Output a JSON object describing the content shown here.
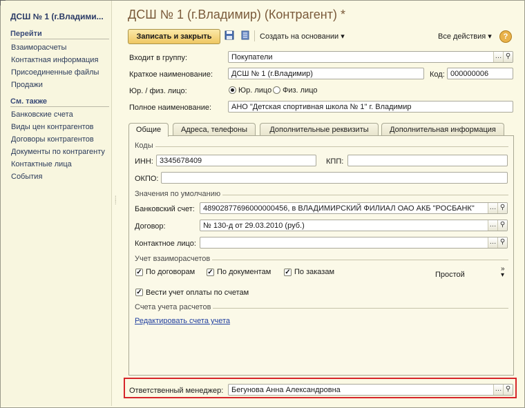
{
  "left": {
    "title": "ДСШ № 1 (г.Владими...",
    "section_go": "Перейти",
    "go_items": [
      "Взаиморасчеты",
      "Контактная информация",
      "Присоединенные файлы",
      "Продажи"
    ],
    "section_see": "См. также",
    "see_items": [
      "Банковские счета",
      "Виды цен контрагентов",
      "Договоры контрагентов",
      "Документы по контрагенту",
      "Контактные лица",
      "События"
    ]
  },
  "header": {
    "title": "ДСШ № 1 (г.Владимир) (Контрагент) *"
  },
  "toolbar": {
    "save_close": "Записать и закрыть",
    "create_based": "Создать на основании",
    "all_actions": "Все действия",
    "help": "?"
  },
  "form": {
    "group_label": "Входит в группу:",
    "group_value": "Покупатели",
    "short_name_label": "Краткое наименование:",
    "short_name_value": "ДСШ № 1 (г.Владимир)",
    "code_label": "Код:",
    "code_value": "000000006",
    "entity_label": "Юр. / физ. лицо:",
    "entity_options": [
      "Юр. лицо",
      "Физ. лицо"
    ],
    "full_name_label": "Полное наименование:",
    "full_name_value": "АНО \"Детская спортивная школа  № 1\" г. Владимир"
  },
  "tabs": [
    "Общие",
    "Адреса, телефоны",
    "Дополнительные реквизиты",
    "Дополнительная информация"
  ],
  "general": {
    "codes_group": "Коды",
    "inn_label": "ИНН:",
    "inn_value": "3345678409",
    "kpp_label": "КПП:",
    "kpp_value": "",
    "okpo_label": "ОКПО:",
    "okpo_value": "",
    "defaults_group": "Значения по умолчанию",
    "bank_label": "Банковский счет:",
    "bank_value": "48902877696000000456, в ВЛАДИМИРСКИЙ ФИЛИАЛ ОАО АКБ \"РОСБАНК\"",
    "contract_label": "Договор:",
    "contract_value": "№ 130-д от 29.03.2010 (руб.)",
    "contact_label": "Контактное лицо:",
    "contact_value": "",
    "settlement_group": "Учет взаиморасчетов",
    "by_contracts": "По договорам",
    "by_documents": "По документам",
    "by_orders": "По заказам",
    "mode": "Простой",
    "pay_by_invoices": "Вести учет оплаты по счетам",
    "accounts_group": "Счета учета расчетов",
    "edit_accounts_link": "Редактировать счета учета"
  },
  "manager": {
    "label": "Ответственный менеджер:",
    "value": "Бегунова Анна Александровна"
  },
  "colors": {
    "highlight": "#d6252a",
    "accent_button": "#efc762",
    "title": "#7a5a3a",
    "link": "#2140a0"
  }
}
